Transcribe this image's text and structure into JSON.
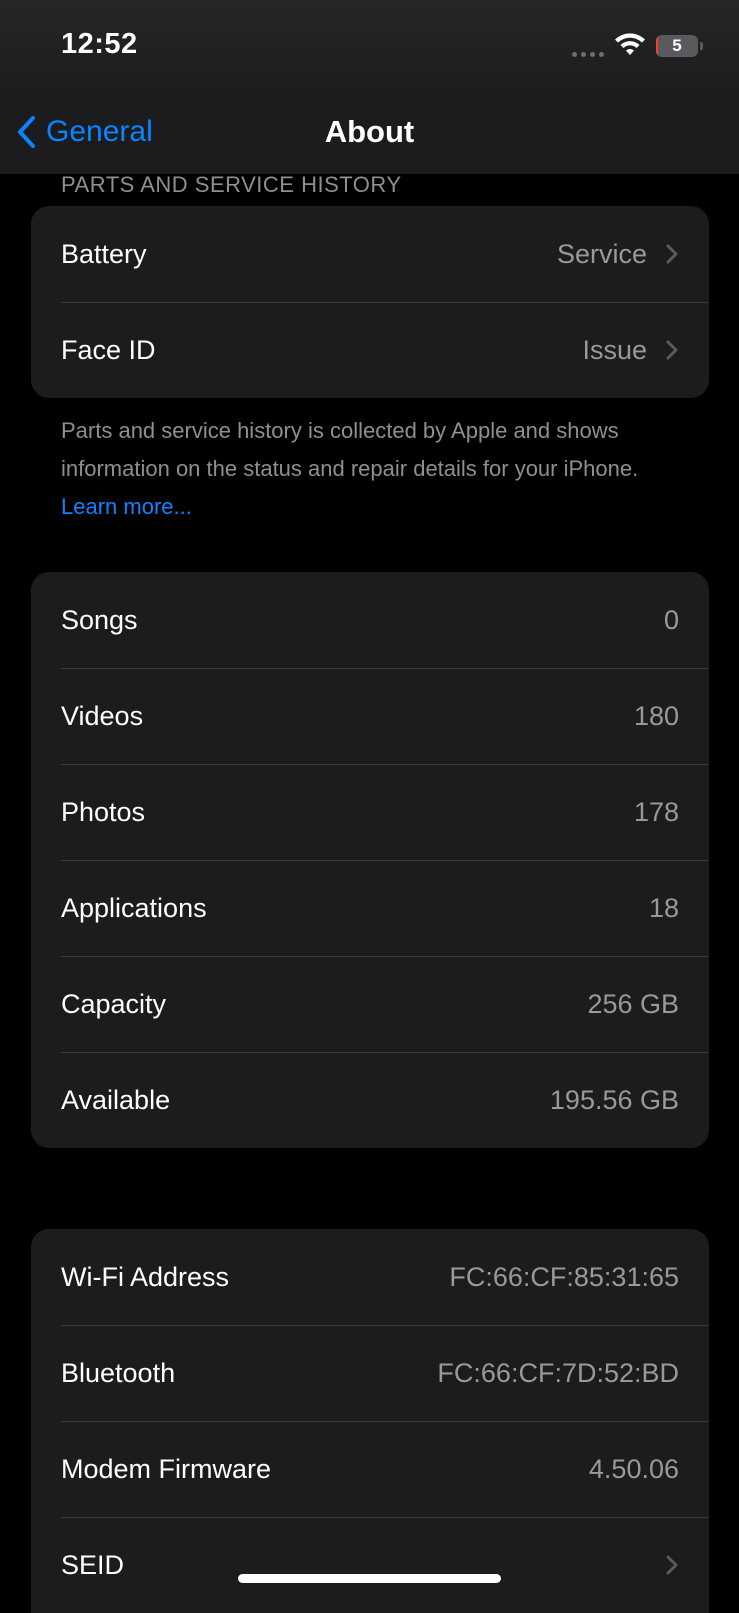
{
  "status_bar": {
    "time": "12:52",
    "battery_level": "5",
    "battery_fraction": 0.05
  },
  "nav": {
    "back_label": "General",
    "title": "About"
  },
  "parts_section": {
    "header": "PARTS AND SERVICE HISTORY",
    "rows": [
      {
        "label": "Battery",
        "value": "Service"
      },
      {
        "label": "Face ID",
        "value": "Issue"
      }
    ],
    "footnote": "Parts and service history is collected by Apple and shows information on the status and repair details for your iPhone.",
    "learn_more": "Learn more..."
  },
  "media_section": {
    "rows": [
      {
        "label": "Songs",
        "value": "0"
      },
      {
        "label": "Videos",
        "value": "180"
      },
      {
        "label": "Photos",
        "value": "178"
      },
      {
        "label": "Applications",
        "value": "18"
      },
      {
        "label": "Capacity",
        "value": "256 GB"
      },
      {
        "label": "Available",
        "value": "195.56 GB"
      }
    ]
  },
  "network_section": {
    "rows": [
      {
        "label": "Wi-Fi Address",
        "value": "FC:66:CF:85:31:65"
      },
      {
        "label": "Bluetooth",
        "value": "FC:66:CF:7D:52:BD"
      },
      {
        "label": "Modem Firmware",
        "value": "4.50.06"
      },
      {
        "label": "SEID",
        "value": ""
      }
    ]
  },
  "colors": {
    "accent": "#0a84ff",
    "background": "#000000",
    "group_background": "#1c1c1e",
    "secondary_text": "#98989d",
    "battery_low": "#ff3b30"
  }
}
